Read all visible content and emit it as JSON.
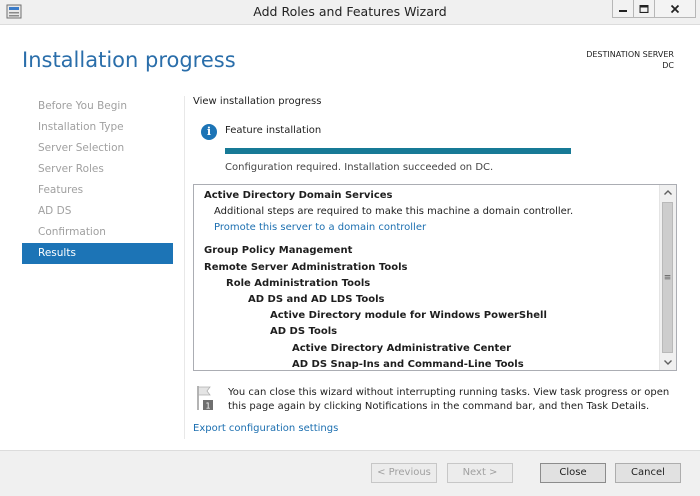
{
  "window": {
    "title": "Add Roles and Features Wizard"
  },
  "header": {
    "page_title": "Installation progress",
    "destination_label": "DESTINATION SERVER",
    "destination_value": "DC"
  },
  "nav": {
    "items": [
      {
        "label": "Before You Begin",
        "active": false
      },
      {
        "label": "Installation Type",
        "active": false
      },
      {
        "label": "Server Selection",
        "active": false
      },
      {
        "label": "Server Roles",
        "active": false
      },
      {
        "label": "Features",
        "active": false
      },
      {
        "label": "AD DS",
        "active": false
      },
      {
        "label": "Confirmation",
        "active": false
      },
      {
        "label": "Results",
        "active": true
      }
    ]
  },
  "content": {
    "subheading": "View installation progress",
    "feature_label": "Feature installation",
    "progress_percent": 100,
    "status_text": "Configuration required. Installation succeeded on DC.",
    "results": [
      {
        "text": "Active Directory Domain Services",
        "level": 0,
        "bold": true,
        "link": false
      },
      {
        "text": "Additional steps are required to make this machine a domain controller.",
        "level": 1,
        "bold": false,
        "link": false
      },
      {
        "text": "Promote this server to a domain controller",
        "level": 1,
        "bold": false,
        "link": true
      },
      {
        "text": "Group Policy Management",
        "level": 0,
        "bold": true,
        "link": false
      },
      {
        "text": "Remote Server Administration Tools",
        "level": 0,
        "bold": true,
        "link": false
      },
      {
        "text": "Role Administration Tools",
        "level": 1,
        "bold": true,
        "link": false
      },
      {
        "text": "AD DS and AD LDS Tools",
        "level": 2,
        "bold": true,
        "link": false
      },
      {
        "text": "Active Directory module for Windows PowerShell",
        "level": 3,
        "bold": true,
        "link": false
      },
      {
        "text": "AD DS Tools",
        "level": 3,
        "bold": true,
        "link": false
      },
      {
        "text": "Active Directory Administrative Center",
        "level": 4,
        "bold": true,
        "link": false
      },
      {
        "text": "AD DS Snap-Ins and Command-Line Tools",
        "level": 4,
        "bold": true,
        "link": false
      }
    ],
    "note_text": "You can close this wizard without interrupting running tasks. View task progress or open this page again by clicking Notifications in the command bar, and then Task Details.",
    "export_link": "Export configuration settings"
  },
  "footer": {
    "previous_label": "< Previous",
    "next_label": "Next >",
    "close_label": "Close",
    "cancel_label": "Cancel"
  },
  "colors": {
    "accent": "#1c74b6",
    "progress": "#177a96",
    "title_blue": "#2a6eaa",
    "link": "#1c6fb0"
  },
  "icons": [
    "server-manager-icon",
    "minimize-icon",
    "maximize-icon",
    "close-icon",
    "info-icon",
    "flag-notification-icon",
    "scroll-up-icon",
    "scroll-down-icon"
  ]
}
